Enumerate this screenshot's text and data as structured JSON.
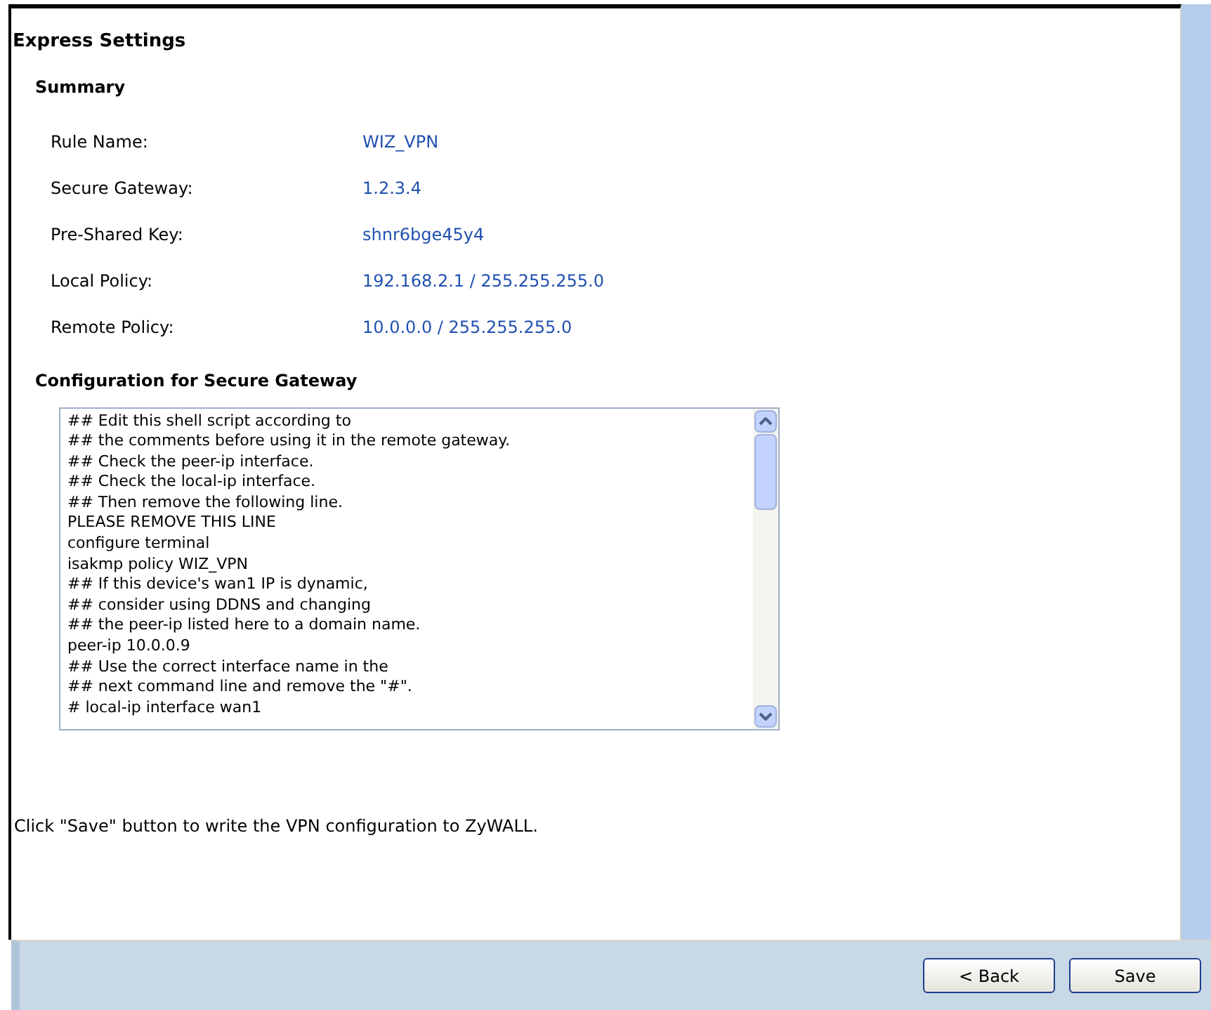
{
  "title": "Express Settings",
  "summary": {
    "heading": "Summary",
    "rows": [
      {
        "label": "Rule Name:",
        "value": "WIZ_VPN"
      },
      {
        "label": "Secure Gateway:",
        "value": "1.2.3.4"
      },
      {
        "label": "Pre-Shared Key:",
        "value": "shnr6bge45y4"
      },
      {
        "label": "Local Policy:",
        "value": "192.168.2.1 / 255.255.255.0"
      },
      {
        "label": "Remote Policy:",
        "value": "10.0.0.0 / 255.255.255.0"
      }
    ]
  },
  "config": {
    "heading": "Configuration for Secure Gateway",
    "lines": [
      "## Edit this shell script according to",
      "## the comments before using it in the remote gateway.",
      "## Check the peer-ip interface.",
      "## Check the local-ip interface.",
      "## Then remove the following line.",
      "PLEASE REMOVE THIS LINE",
      "configure terminal",
      "isakmp policy WIZ_VPN",
      "## If this device's wan1 IP is dynamic,",
      "## consider using DDNS and changing",
      "## the peer-ip listed here to a domain name.",
      "peer-ip 10.0.0.9",
      "## Use the correct interface name in the",
      "## next command line and remove the \"#\".",
      "# local-ip interface wan1"
    ]
  },
  "note": "Click \"Save\" button to write the VPN configuration to ZyWALL.",
  "buttons": [
    "< Back",
    "Save"
  ]
}
